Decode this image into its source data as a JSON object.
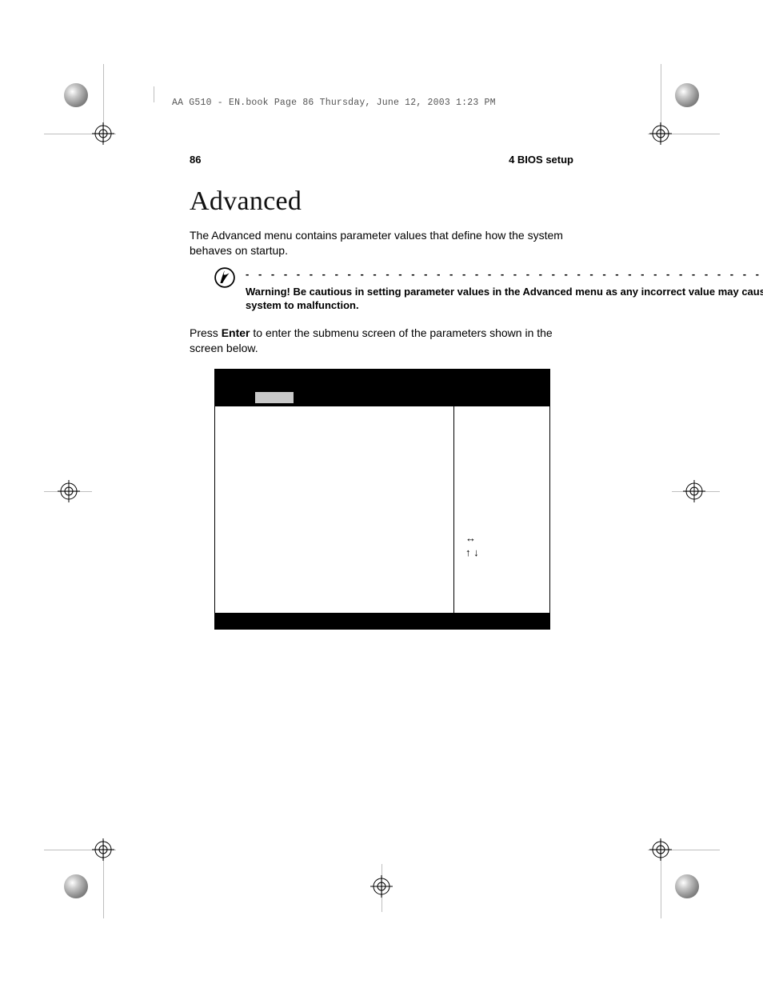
{
  "header_tag": "AA G510 - EN.book  Page 86  Thursday, June 12, 2003  1:23 PM",
  "page_number": "86",
  "section_label": "4 BIOS setup",
  "title": "Advanced",
  "intro_para": "The Advanced menu contains parameter values that define how the system behaves on startup.",
  "warning_label": "Warning! ",
  "warning_text": "Be cautious in setting parameter values in the Advanced menu as any incorrect value may cause the system to malfunction.",
  "enter_pre": "Press ",
  "enter_key": "Enter",
  "enter_post": " to enter the submenu screen of the parameters shown in the screen below.",
  "nav_h": "↔",
  "nav_v": "↑ ↓",
  "dots": "- - - - - - - - - - - - - - - - - - - - - - - - - - - - - - - - - - - - - - - - - - - -"
}
